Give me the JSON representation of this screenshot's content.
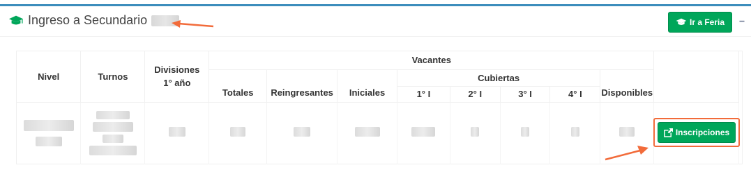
{
  "panel": {
    "title": "Ingreso a Secundario",
    "title_icon": "graduation-cap-icon",
    "feria_button_label": "Ir a Feria",
    "feria_button_icon": "graduation-cap-icon",
    "collapse_symbol": "–"
  },
  "table": {
    "headers": {
      "nivel": "Nivel",
      "turnos": "Turnos",
      "divisiones": "Divisiones",
      "divisiones_sub": "1° año",
      "vacantes": "Vacantes",
      "totales": "Totales",
      "reingresantes": "Reingresantes",
      "iniciales": "Iniciales",
      "cubiertas": "Cubiertas",
      "c1": "1° I",
      "c2": "2° I",
      "c3": "3° I",
      "c4": "4° I",
      "disponibles": "Disponibles"
    }
  },
  "actions": {
    "inscripciones_label": "Inscripciones",
    "inscripciones_icon": "external-link-icon"
  },
  "colors": {
    "accent_top": "#3c8dbc",
    "button_green": "#00a65a",
    "highlight_orange": "#f26b3a"
  }
}
